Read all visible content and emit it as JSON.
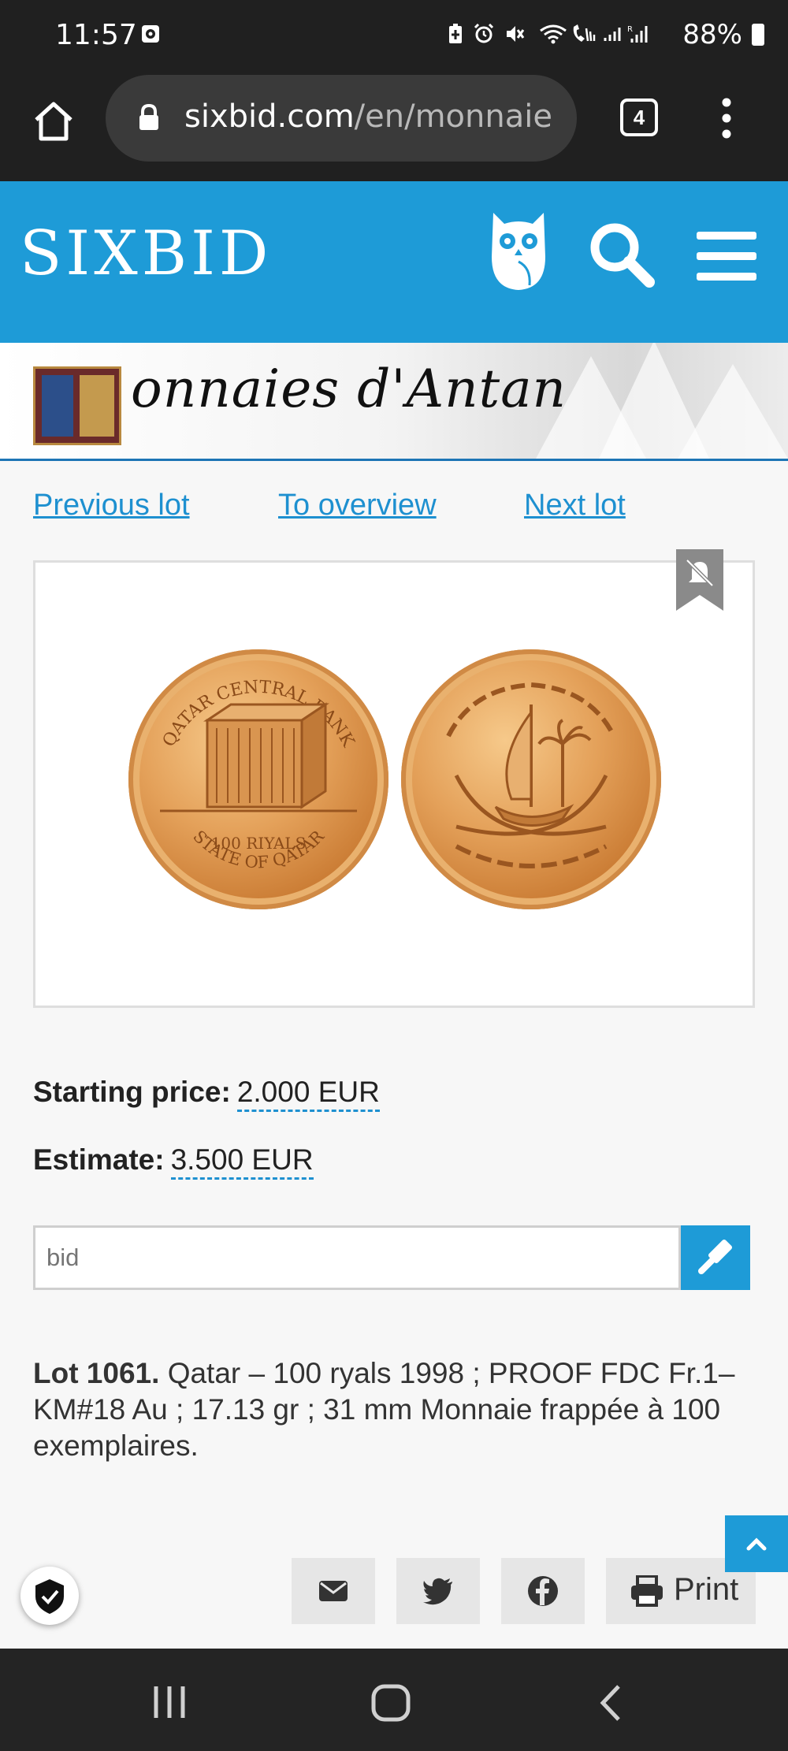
{
  "status_bar": {
    "time": "11:57",
    "battery_percent": "88%",
    "icons": [
      "photo-notification-icon",
      "battery-saver-icon",
      "alarm-icon",
      "mute-icon",
      "wifi-icon",
      "wifi-call-icon",
      "signal-icon",
      "roaming-signal-icon",
      "battery-icon"
    ]
  },
  "browser": {
    "url_host": "sixbid.com",
    "url_path": "/en/monnaie",
    "tab_count": "4"
  },
  "site_header": {
    "logo": "SIXBID",
    "brand_color": "#1e9bd7"
  },
  "shop_banner": {
    "name": "onnaies d'Antan"
  },
  "lot_nav": {
    "previous": "Previous lot",
    "overview": "To overview",
    "next": "Next lot"
  },
  "coin_image": {
    "obverse_top": "QATAR CENTRAL BANK",
    "obverse_bottom_1": "100 RIYALS",
    "obverse_bottom_2": "STATE OF QATAR"
  },
  "prices": {
    "starting_label": "Starting price:",
    "starting_value": "2.000 EUR",
    "estimate_label": "Estimate:",
    "estimate_value": "3.500 EUR"
  },
  "bid": {
    "placeholder": "bid"
  },
  "lot": {
    "number": "Lot 1061.",
    "description": "Qatar – 100 ryals 1998 ; PROOF FDC Fr.1– KM#18 Au ; 17.13 gr ; 31 mm Monnaie frappée à 100 exemplaires."
  },
  "share": {
    "print_label": "Print"
  }
}
